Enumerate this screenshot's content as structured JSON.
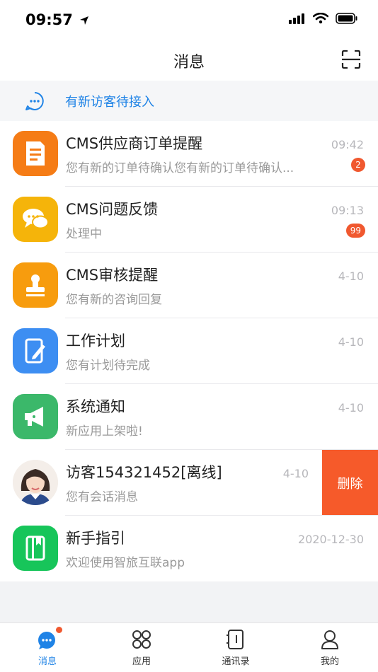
{
  "status": {
    "time": "09:57"
  },
  "nav": {
    "title": "消息"
  },
  "visitor_banner": {
    "text": "有新访客待接入"
  },
  "messages": [
    {
      "title": "CMS供应商订单提醒",
      "preview": "您有新的订单待确认您有新的订单待确认...",
      "time": "09:42",
      "badge": "2",
      "icon": "document-icon",
      "color": "#f57c16"
    },
    {
      "title": "CMS问题反馈",
      "preview": "处理中",
      "time": "09:13",
      "badge": "99",
      "icon": "chat-bubbles-icon",
      "color": "#f5b40a"
    },
    {
      "title": "CMS审核提醒",
      "preview": "您有新的咨询回复",
      "time": "4-10",
      "icon": "stamp-icon",
      "color": "#f79c0e"
    },
    {
      "title": "工作计划",
      "preview": "您有计划待完成",
      "time": "4-10",
      "icon": "notebook-pen-icon",
      "color": "#3d8ef2"
    },
    {
      "title": "系统通知",
      "preview": "新应用上架啦!",
      "time": "4-10",
      "icon": "megaphone-icon",
      "color": "#3bb86a"
    },
    {
      "title": "访客154321452[离线]",
      "preview": "您有会话消息",
      "time": "4-10",
      "icon": "visitor-avatar",
      "delete_label": "删除"
    },
    {
      "title": "新手指引",
      "preview": "欢迎使用智旅互联app",
      "time": "2020-12-30",
      "icon": "guide-book-icon",
      "color": "#17c55a"
    }
  ],
  "tabs": [
    {
      "label": "消息",
      "icon": "message-icon",
      "active": true,
      "dot": true
    },
    {
      "label": "应用",
      "icon": "apps-icon"
    },
    {
      "label": "通讯录",
      "icon": "contacts-icon"
    },
    {
      "label": "我的",
      "icon": "profile-icon"
    }
  ],
  "colors": {
    "accent": "#1f83e6",
    "badge": "#f0582f",
    "delete": "#f65a2a"
  }
}
